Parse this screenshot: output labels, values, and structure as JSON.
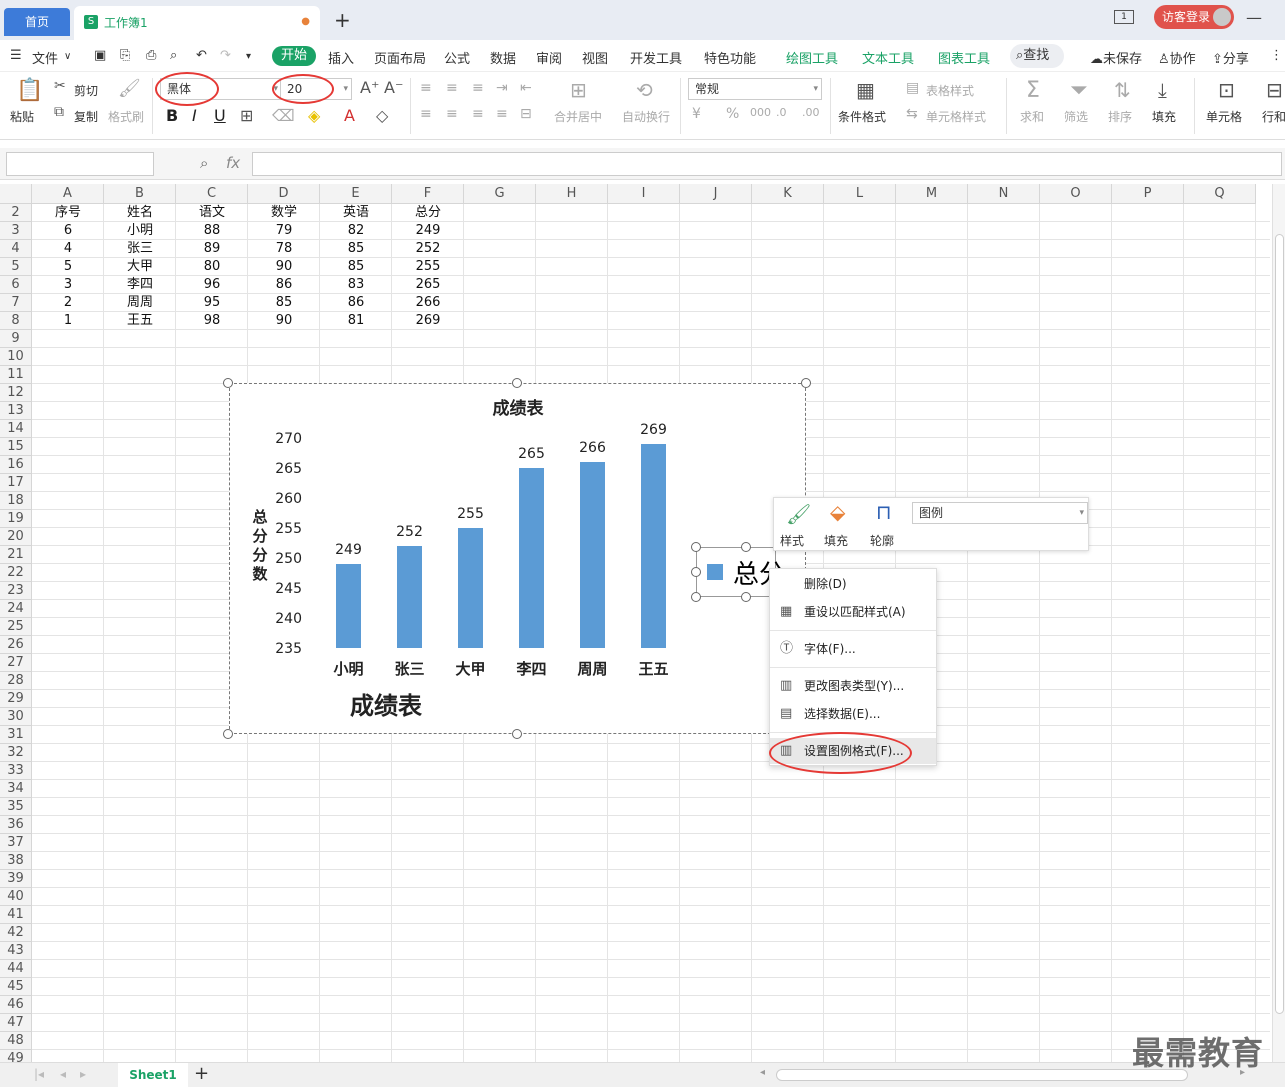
{
  "tabs": {
    "home": "首页",
    "workbook": "工作簿1",
    "workbook_icon": "S",
    "new_tab": "+"
  },
  "titlebar": {
    "window_badge": "1",
    "login": "访客登录"
  },
  "menu": {
    "file": "文件",
    "items": [
      "开始",
      "插入",
      "页面布局",
      "公式",
      "数据",
      "审阅",
      "视图",
      "开发工具",
      "特色功能"
    ],
    "tool_items": [
      "绘图工具",
      "文本工具",
      "图表工具"
    ],
    "search": "查找",
    "unsaved": "未保存",
    "collab": "协作",
    "share": "分享"
  },
  "ribbon": {
    "paste": "粘贴",
    "cut": "剪切",
    "copy": "复制",
    "format_painter": "格式刷",
    "font_name": "黑体",
    "font_size": "20",
    "merge_center": "合并居中",
    "wrap": "自动换行",
    "number_format": "常规",
    "cond_format": "条件格式",
    "table_style": "表格样式",
    "cell_style": "单元格样式",
    "sum": "求和",
    "filter": "筛选",
    "sort": "排序",
    "fill": "填充",
    "cell": "单元格",
    "row_col": "行和"
  },
  "formula_bar": {
    "fx": "fx",
    "value": ""
  },
  "columns": [
    "A",
    "B",
    "C",
    "D",
    "E",
    "F",
    "G",
    "H",
    "I",
    "J",
    "K",
    "L",
    "M",
    "N",
    "O",
    "P",
    "Q"
  ],
  "rows_start": 2,
  "rows_end": 49,
  "table": {
    "headers": [
      "序号",
      "姓名",
      "语文",
      "数学",
      "英语",
      "总分"
    ],
    "rows": [
      [
        "6",
        "小明",
        "88",
        "79",
        "82",
        "249"
      ],
      [
        "4",
        "张三",
        "89",
        "78",
        "85",
        "252"
      ],
      [
        "5",
        "大甲",
        "80",
        "90",
        "85",
        "255"
      ],
      [
        "3",
        "李四",
        "96",
        "86",
        "83",
        "265"
      ],
      [
        "2",
        "周周",
        "95",
        "85",
        "86",
        "266"
      ],
      [
        "1",
        "王五",
        "98",
        "90",
        "81",
        "269"
      ]
    ]
  },
  "chart_data": {
    "type": "bar",
    "title": "成绩表",
    "subtitle_text": "成绩表",
    "ylabel": "总分分数",
    "xlabel": "",
    "categories": [
      "小明",
      "张三",
      "大甲",
      "李四",
      "周周",
      "王五"
    ],
    "series": [
      {
        "name": "总分",
        "values": [
          249,
          252,
          255,
          265,
          266,
          269
        ]
      }
    ],
    "ylim": [
      235,
      270
    ],
    "yticks": [
      235,
      240,
      245,
      250,
      255,
      260,
      265,
      270
    ],
    "grid": false,
    "legend": "right",
    "bar_color": "#5b9bd5"
  },
  "legend_text": "总分",
  "mini_toolbar": {
    "style": "样式",
    "fill": "填充",
    "outline": "轮廓",
    "selector": "图例"
  },
  "context_menu": [
    {
      "label": "删除(D)",
      "icon": "none"
    },
    {
      "label": "重设以匹配样式(A)",
      "icon": "reset-icon"
    },
    {
      "label": "字体(F)...",
      "icon": "font-icon"
    },
    {
      "label": "更改图表类型(Y)...",
      "icon": "chart-type-icon"
    },
    {
      "label": "选择数据(E)...",
      "icon": "select-data-icon"
    },
    {
      "label": "设置图例格式(F)...",
      "icon": "legend-format-icon"
    }
  ],
  "sheet": {
    "name": "Sheet1",
    "add": "+"
  },
  "watermark": "最需教育"
}
